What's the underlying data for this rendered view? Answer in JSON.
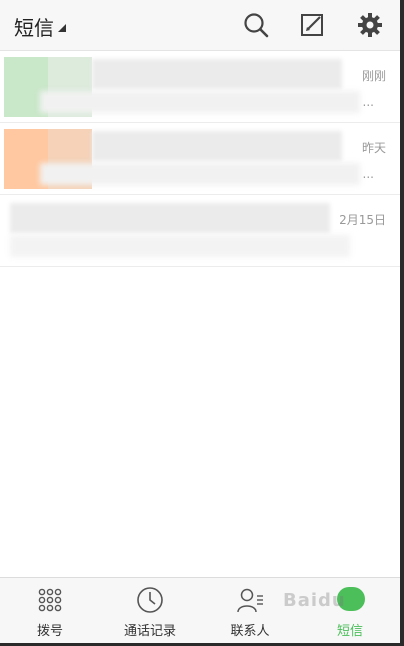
{
  "header": {
    "title": "短信"
  },
  "messages": [
    {
      "time": "刚刚",
      "preview_suffix": "..."
    },
    {
      "time": "昨天",
      "preview_suffix": "..."
    },
    {
      "time": "2月15日",
      "preview_suffix": ""
    }
  ],
  "nav": {
    "dial_label": "拨号",
    "calls_label": "通话记录",
    "contacts_label": "联系人",
    "sms_label": "短信"
  },
  "watermark": "Baidu",
  "colors": {
    "accent": "#4cbf5b",
    "header_bg": "#f7f7f7",
    "text_secondary": "#999999"
  }
}
